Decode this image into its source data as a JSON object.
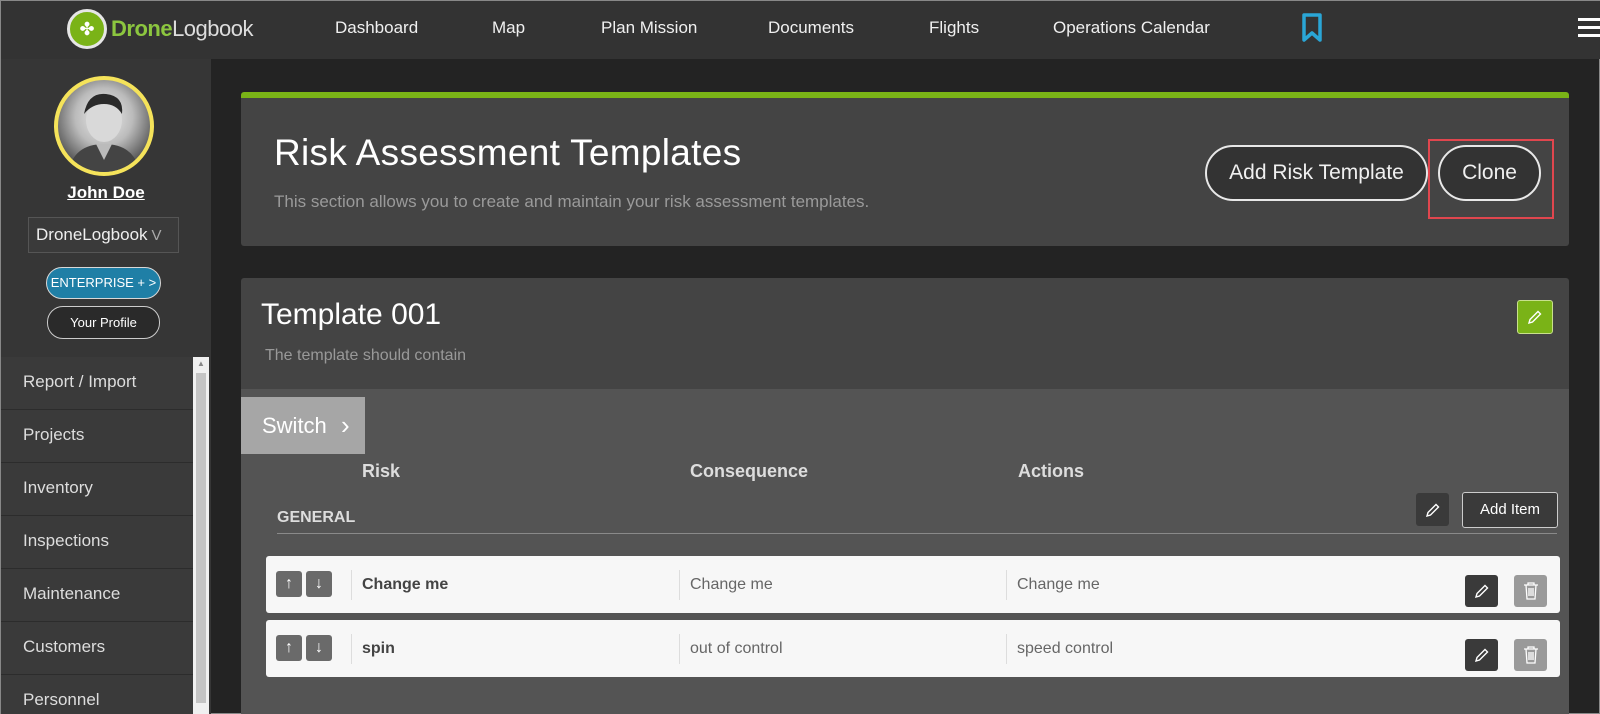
{
  "brand": {
    "name_highlight": "Drone",
    "name_rest": "Logbook"
  },
  "nav": {
    "items": [
      "Dashboard",
      "Map",
      "Plan Mission",
      "Documents",
      "Flights",
      "Operations Calendar"
    ]
  },
  "sidebar": {
    "username": "John Doe",
    "org": "DroneLogbook",
    "org_chevron": "V",
    "enterprise_label": "ENTERPRISE + >",
    "profile_label": "Your Profile",
    "menu": [
      "Report / Import",
      "Projects",
      "Inventory",
      "Inspections",
      "Maintenance",
      "Customers",
      "Personnel"
    ]
  },
  "header": {
    "title": "Risk Assessment Templates",
    "description": "This section allows you to create and maintain your risk assessment templates.",
    "add_button": "Add Risk Template",
    "clone_button": "Clone"
  },
  "template": {
    "title": "Template 001",
    "description": "The template should contain",
    "switch_label": "Switch",
    "columns": [
      "Risk",
      "Consequence",
      "Actions"
    ],
    "section": "GENERAL",
    "add_item_label": "Add Item",
    "rows": [
      {
        "risk": "Change me",
        "consequence": "Change me",
        "actions": "Change me"
      },
      {
        "risk": "spin",
        "consequence": "out of control",
        "actions": "speed control"
      }
    ]
  },
  "colors": {
    "accent_green": "#7ab317",
    "highlight_red": "#e0464e",
    "enterprise_blue": "#1f7fa6"
  }
}
